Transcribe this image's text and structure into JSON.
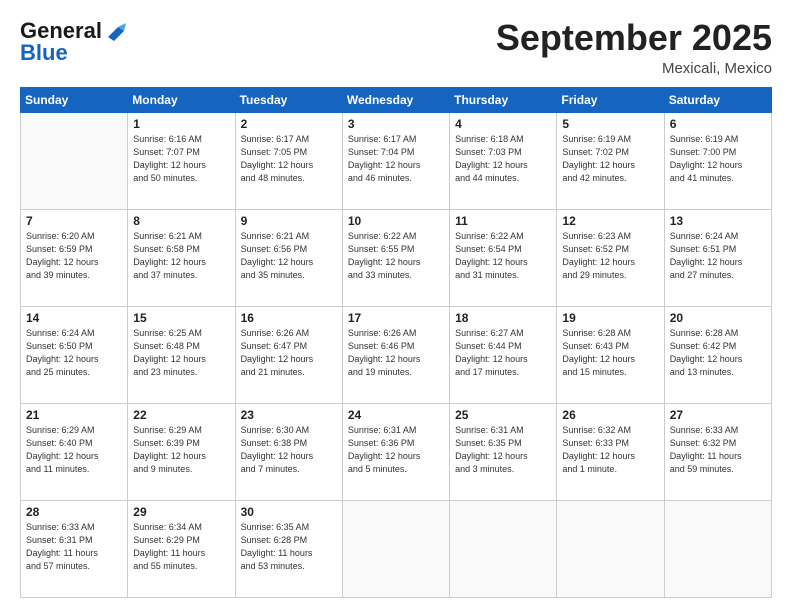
{
  "header": {
    "logo_line1": "General",
    "logo_line2": "Blue",
    "month": "September 2025",
    "location": "Mexicali, Mexico"
  },
  "days_of_week": [
    "Sunday",
    "Monday",
    "Tuesday",
    "Wednesday",
    "Thursday",
    "Friday",
    "Saturday"
  ],
  "weeks": [
    [
      {
        "day": "",
        "info": ""
      },
      {
        "day": "1",
        "info": "Sunrise: 6:16 AM\nSunset: 7:07 PM\nDaylight: 12 hours\nand 50 minutes."
      },
      {
        "day": "2",
        "info": "Sunrise: 6:17 AM\nSunset: 7:05 PM\nDaylight: 12 hours\nand 48 minutes."
      },
      {
        "day": "3",
        "info": "Sunrise: 6:17 AM\nSunset: 7:04 PM\nDaylight: 12 hours\nand 46 minutes."
      },
      {
        "day": "4",
        "info": "Sunrise: 6:18 AM\nSunset: 7:03 PM\nDaylight: 12 hours\nand 44 minutes."
      },
      {
        "day": "5",
        "info": "Sunrise: 6:19 AM\nSunset: 7:02 PM\nDaylight: 12 hours\nand 42 minutes."
      },
      {
        "day": "6",
        "info": "Sunrise: 6:19 AM\nSunset: 7:00 PM\nDaylight: 12 hours\nand 41 minutes."
      }
    ],
    [
      {
        "day": "7",
        "info": "Sunrise: 6:20 AM\nSunset: 6:59 PM\nDaylight: 12 hours\nand 39 minutes."
      },
      {
        "day": "8",
        "info": "Sunrise: 6:21 AM\nSunset: 6:58 PM\nDaylight: 12 hours\nand 37 minutes."
      },
      {
        "day": "9",
        "info": "Sunrise: 6:21 AM\nSunset: 6:56 PM\nDaylight: 12 hours\nand 35 minutes."
      },
      {
        "day": "10",
        "info": "Sunrise: 6:22 AM\nSunset: 6:55 PM\nDaylight: 12 hours\nand 33 minutes."
      },
      {
        "day": "11",
        "info": "Sunrise: 6:22 AM\nSunset: 6:54 PM\nDaylight: 12 hours\nand 31 minutes."
      },
      {
        "day": "12",
        "info": "Sunrise: 6:23 AM\nSunset: 6:52 PM\nDaylight: 12 hours\nand 29 minutes."
      },
      {
        "day": "13",
        "info": "Sunrise: 6:24 AM\nSunset: 6:51 PM\nDaylight: 12 hours\nand 27 minutes."
      }
    ],
    [
      {
        "day": "14",
        "info": "Sunrise: 6:24 AM\nSunset: 6:50 PM\nDaylight: 12 hours\nand 25 minutes."
      },
      {
        "day": "15",
        "info": "Sunrise: 6:25 AM\nSunset: 6:48 PM\nDaylight: 12 hours\nand 23 minutes."
      },
      {
        "day": "16",
        "info": "Sunrise: 6:26 AM\nSunset: 6:47 PM\nDaylight: 12 hours\nand 21 minutes."
      },
      {
        "day": "17",
        "info": "Sunrise: 6:26 AM\nSunset: 6:46 PM\nDaylight: 12 hours\nand 19 minutes."
      },
      {
        "day": "18",
        "info": "Sunrise: 6:27 AM\nSunset: 6:44 PM\nDaylight: 12 hours\nand 17 minutes."
      },
      {
        "day": "19",
        "info": "Sunrise: 6:28 AM\nSunset: 6:43 PM\nDaylight: 12 hours\nand 15 minutes."
      },
      {
        "day": "20",
        "info": "Sunrise: 6:28 AM\nSunset: 6:42 PM\nDaylight: 12 hours\nand 13 minutes."
      }
    ],
    [
      {
        "day": "21",
        "info": "Sunrise: 6:29 AM\nSunset: 6:40 PM\nDaylight: 12 hours\nand 11 minutes."
      },
      {
        "day": "22",
        "info": "Sunrise: 6:29 AM\nSunset: 6:39 PM\nDaylight: 12 hours\nand 9 minutes."
      },
      {
        "day": "23",
        "info": "Sunrise: 6:30 AM\nSunset: 6:38 PM\nDaylight: 12 hours\nand 7 minutes."
      },
      {
        "day": "24",
        "info": "Sunrise: 6:31 AM\nSunset: 6:36 PM\nDaylight: 12 hours\nand 5 minutes."
      },
      {
        "day": "25",
        "info": "Sunrise: 6:31 AM\nSunset: 6:35 PM\nDaylight: 12 hours\nand 3 minutes."
      },
      {
        "day": "26",
        "info": "Sunrise: 6:32 AM\nSunset: 6:33 PM\nDaylight: 12 hours\nand 1 minute."
      },
      {
        "day": "27",
        "info": "Sunrise: 6:33 AM\nSunset: 6:32 PM\nDaylight: 11 hours\nand 59 minutes."
      }
    ],
    [
      {
        "day": "28",
        "info": "Sunrise: 6:33 AM\nSunset: 6:31 PM\nDaylight: 11 hours\nand 57 minutes."
      },
      {
        "day": "29",
        "info": "Sunrise: 6:34 AM\nSunset: 6:29 PM\nDaylight: 11 hours\nand 55 minutes."
      },
      {
        "day": "30",
        "info": "Sunrise: 6:35 AM\nSunset: 6:28 PM\nDaylight: 11 hours\nand 53 minutes."
      },
      {
        "day": "",
        "info": ""
      },
      {
        "day": "",
        "info": ""
      },
      {
        "day": "",
        "info": ""
      },
      {
        "day": "",
        "info": ""
      }
    ]
  ]
}
